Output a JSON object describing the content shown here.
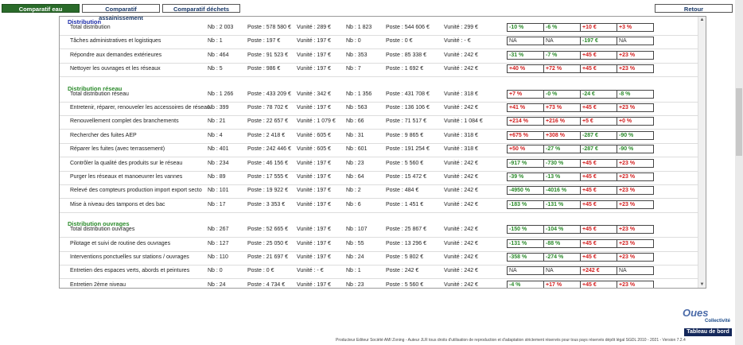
{
  "tabs": [
    {
      "label": "Comparatif eau",
      "active": true
    },
    {
      "label": "Comparatif assainissement",
      "active": false
    },
    {
      "label": "Comparatif déchets",
      "active": false
    }
  ],
  "retour_label": "Retour",
  "colors": {
    "active_tab": "#2a6b2a",
    "section_blue": "#1a2aa8",
    "section_green": "#2a8a2a",
    "negative": "#2a8a2a",
    "positive": "#d21d1d"
  },
  "sections": [
    {
      "title": "Distribution",
      "rows": [
        {
          "label": "Total distribution",
          "nb1": "Nb : 2 003",
          "poste1": "Poste : 578 580 €",
          "unit1": "Vunité : 289 €",
          "nb2": "Nb : 1 823",
          "poste2": "Poste : 544 606 €",
          "unit2": "Vunité : 299 €",
          "boxes": [
            "-10 %",
            "-6 %",
            "+10 €",
            "+3 %"
          ]
        },
        {
          "label": "Tâches administratives et logistiques",
          "nb1": "Nb : 1",
          "poste1": "Poste : 197 €",
          "unit1": "Vunité : 197 €",
          "nb2": "Nb : 0",
          "poste2": "Poste : 0 €",
          "unit2": "Vunité : - €",
          "boxes": [
            "NA",
            "NA",
            "-197 €",
            "NA"
          ]
        },
        {
          "label": "Répondre aux demandes extérieures",
          "nb1": "Nb : 464",
          "poste1": "Poste : 91 523 €",
          "unit1": "Vunité : 197 €",
          "nb2": "Nb : 353",
          "poste2": "Poste : 85 338 €",
          "unit2": "Vunité : 242 €",
          "boxes": [
            "-31 %",
            "-7 %",
            "+45 €",
            "+23 %"
          ]
        },
        {
          "label": "Nettoyer les ouvrages et les réseaux",
          "nb1": "Nb : 5",
          "poste1": "Poste : 986 €",
          "unit1": "Vunité : 197 €",
          "nb2": "Nb : 7",
          "poste2": "Poste : 1 692 €",
          "unit2": "Vunité : 242 €",
          "boxes": [
            "+40 %",
            "+72 %",
            "+45 €",
            "+23 %"
          ]
        }
      ]
    },
    {
      "title": "Distribution réseau",
      "rows": [
        {
          "label": "Total distribution réseau",
          "nb1": "Nb : 1 266",
          "poste1": "Poste : 433 209 €",
          "unit1": "Vunité : 342 €",
          "nb2": "Nb : 1 356",
          "poste2": "Poste : 431 708 €",
          "unit2": "Vunité : 318 €",
          "boxes": [
            "+7 %",
            "-0 %",
            "-24 €",
            "-8 %"
          ]
        },
        {
          "label": "Entretenir, réparer, renouveler les accessoires de réseau",
          "nb1": "Nb : 399",
          "poste1": "Poste : 78 702 €",
          "unit1": "Vunité : 197 €",
          "nb2": "Nb : 563",
          "poste2": "Poste : 136 106 €",
          "unit2": "Vunité : 242 €",
          "boxes": [
            "+41 %",
            "+73 %",
            "+45 €",
            "+23 %"
          ]
        },
        {
          "label": "Renouvellement complet des branchements",
          "nb1": "Nb : 21",
          "poste1": "Poste : 22 657 €",
          "unit1": "Vunité : 1 079 €",
          "nb2": "Nb : 66",
          "poste2": "Poste : 71 517 €",
          "unit2": "Vunité : 1 084 €",
          "boxes": [
            "+214 %",
            "+216 %",
            "+5 €",
            "+0 %"
          ]
        },
        {
          "label": "Rechercher des fuites AEP",
          "nb1": "Nb : 4",
          "poste1": "Poste : 2 418 €",
          "unit1": "Vunité : 605 €",
          "nb2": "Nb : 31",
          "poste2": "Poste : 9 865 €",
          "unit2": "Vunité : 318 €",
          "boxes": [
            "+675 %",
            "+308 %",
            "-287 €",
            "-90 %"
          ]
        },
        {
          "label": "Réparer les fuites (avec terrassement)",
          "nb1": "Nb : 401",
          "poste1": "Poste : 242 446 €",
          "unit1": "Vunité : 605 €",
          "nb2": "Nb : 601",
          "poste2": "Poste : 191 254 €",
          "unit2": "Vunité : 318 €",
          "boxes": [
            "+50 %",
            "-27 %",
            "-287 €",
            "-90 %"
          ]
        },
        {
          "label": "Contrôler la qualité des produits sur le réseau",
          "nb1": "Nb : 234",
          "poste1": "Poste : 46 156 €",
          "unit1": "Vunité : 197 €",
          "nb2": "Nb : 23",
          "poste2": "Poste : 5 560 €",
          "unit2": "Vunité : 242 €",
          "boxes": [
            "-917 %",
            "-730 %",
            "+45 €",
            "+23 %"
          ]
        },
        {
          "label": "Purger les réseaux et manoeuvrer les vannes",
          "nb1": "Nb : 89",
          "poste1": "Poste : 17 555 €",
          "unit1": "Vunité : 197 €",
          "nb2": "Nb : 64",
          "poste2": "Poste : 15 472 €",
          "unit2": "Vunité : 242 €",
          "boxes": [
            "-39 %",
            "-13 %",
            "+45 €",
            "+23 %"
          ]
        },
        {
          "label": "Relevé des compteurs production import export secto",
          "nb1": "Nb : 101",
          "poste1": "Poste : 19 922 €",
          "unit1": "Vunité : 197 €",
          "nb2": "Nb : 2",
          "poste2": "Poste : 484 €",
          "unit2": "Vunité : 242 €",
          "boxes": [
            "-4950 %",
            "-4016 %",
            "+45 €",
            "+23 %"
          ]
        },
        {
          "label": "Mise à niveau des tampons et des bac",
          "nb1": "Nb : 17",
          "poste1": "Poste : 3 353 €",
          "unit1": "Vunité : 197 €",
          "nb2": "Nb : 6",
          "poste2": "Poste : 1 451 €",
          "unit2": "Vunité : 242 €",
          "boxes": [
            "-183 %",
            "-131 %",
            "+45 €",
            "+23 %"
          ]
        }
      ]
    },
    {
      "title": "Distribution ouvrages",
      "rows": [
        {
          "label": "Total distribution ouvrages",
          "nb1": "Nb : 267",
          "poste1": "Poste : 52 665 €",
          "unit1": "Vunité : 197 €",
          "nb2": "Nb : 107",
          "poste2": "Poste : 25 867 €",
          "unit2": "Vunité : 242 €",
          "boxes": [
            "-150 %",
            "-104 %",
            "+45 €",
            "+23 %"
          ]
        },
        {
          "label": "Pilotage et suivi de routine des ouvrages",
          "nb1": "Nb : 127",
          "poste1": "Poste : 25 050 €",
          "unit1": "Vunité : 197 €",
          "nb2": "Nb : 55",
          "poste2": "Poste : 13 296 €",
          "unit2": "Vunité : 242 €",
          "boxes": [
            "-131 %",
            "-88 %",
            "+45 €",
            "+23 %"
          ]
        },
        {
          "label": "Interventions ponctuelles sur stations / ouvrages",
          "nb1": "Nb : 110",
          "poste1": "Poste : 21 697 €",
          "unit1": "Vunité : 197 €",
          "nb2": "Nb : 24",
          "poste2": "Poste : 5 802 €",
          "unit2": "Vunité : 242 €",
          "boxes": [
            "-358 %",
            "-274 %",
            "+45 €",
            "+23 %"
          ]
        },
        {
          "label": "Entretien des espaces verts, abords et peintures",
          "nb1": "Nb : 0",
          "poste1": "Poste : 0 €",
          "unit1": "Vunité : - €",
          "nb2": "Nb : 1",
          "poste2": "Poste : 242 €",
          "unit2": "Vunité : 242 €",
          "boxes": [
            "NA",
            "NA",
            "+242 €",
            "NA"
          ]
        },
        {
          "label": "Entretien 2ème niveau",
          "nb1": "Nb : 24",
          "poste1": "Poste : 4 734 €",
          "unit1": "Vunité : 197 €",
          "nb2": "Nb : 23",
          "poste2": "Poste : 5 560 €",
          "unit2": "Vunité : 242 €",
          "boxes": [
            "-4 %",
            "+17 %",
            "+45 €",
            "+23 %"
          ]
        }
      ]
    }
  ],
  "logo": {
    "brand": "Oues",
    "sub": "Collectivité"
  },
  "tableau_label": "Tableau de bord",
  "footer": "Producteur Editeur Société AMI Zoning - Auteur JLR tous droits d'utilisation de reproduction et d'adaptation strictement réservés pour tous pays réservés dépôt légal SGDL 2010 - 2021 - Version 7.2.4"
}
